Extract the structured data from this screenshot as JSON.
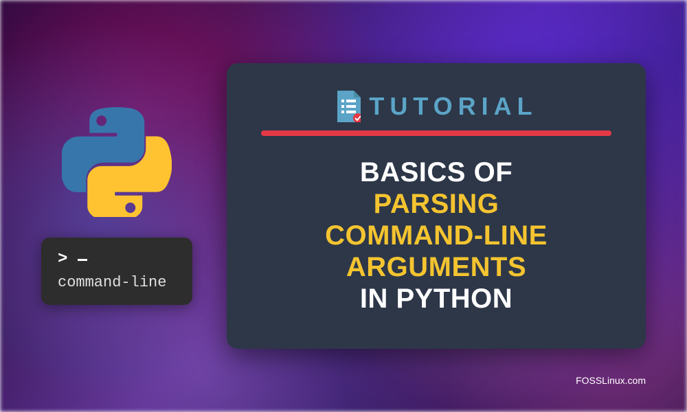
{
  "tutorial": {
    "header_label": "TUTORIAL",
    "title_line1": "BASICS OF",
    "title_line2": "PARSING",
    "title_line3": "COMMAND-LINE",
    "title_line4": "ARGUMENTS",
    "title_line5": "IN PYTHON"
  },
  "terminal": {
    "prompt": ">",
    "text": "command-line"
  },
  "watermark": "FOSSLinux.com",
  "icons": {
    "python_logo": "python-logo",
    "document": "document-checklist-icon"
  },
  "colors": {
    "card_bg": "#2d3748",
    "accent_red": "#e63946",
    "accent_teal": "#5ba4c7",
    "accent_yellow": "#f4c430",
    "terminal_bg": "#2d2d2d"
  }
}
